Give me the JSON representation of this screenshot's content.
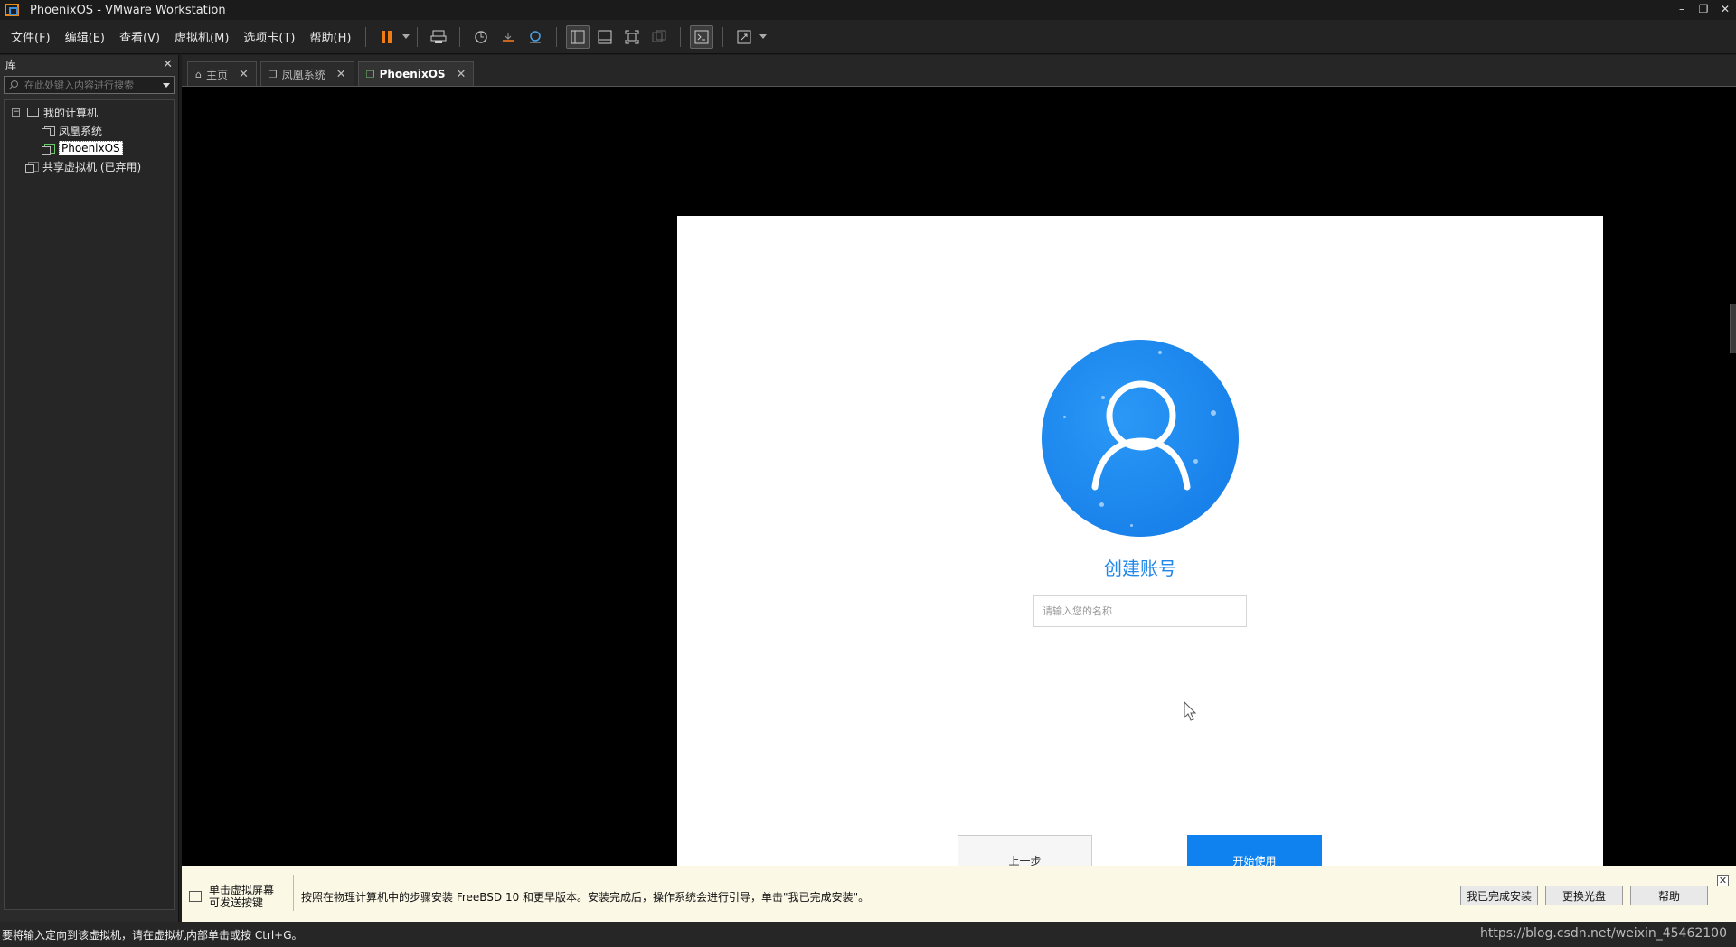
{
  "window": {
    "title": "PhoenixOS - VMware Workstation",
    "minimize": "–",
    "restore": "❐",
    "close": "✕"
  },
  "menu": [
    {
      "label": "文件(F)"
    },
    {
      "label": "编辑(E)"
    },
    {
      "label": "查看(V)"
    },
    {
      "label": "虚拟机(M)"
    },
    {
      "label": "选项卡(T)"
    },
    {
      "label": "帮助(H)"
    }
  ],
  "library": {
    "title": "库",
    "search_placeholder": "在此处键入内容进行搜索",
    "tree": {
      "my_computer": "我的计算机",
      "vm1": "凤凰系统",
      "vm2": "PhoenixOS",
      "shared": "共享虚拟机 (已弃用)"
    }
  },
  "tabs": [
    {
      "label": "主页"
    },
    {
      "label": "凤凰系统"
    },
    {
      "label": "PhoenixOS"
    }
  ],
  "guest": {
    "title": "创建账号",
    "name_placeholder": "请输入您的名称",
    "prev_label": "上一步",
    "start_label": "开始使用",
    "accent": "#1f86ea"
  },
  "hint": {
    "click_line1": "单击虚拟屏幕",
    "click_line2": "可发送按键",
    "message": "按照在物理计算机中的步骤安装 FreeBSD 10 和更早版本。安装完成后，操作系统会进行引导，单击\"我已完成安装\"。",
    "btn_done": "我已完成安装",
    "btn_change_disc": "更换光盘",
    "btn_help": "帮助"
  },
  "status": {
    "text": "要将输入定向到该虚拟机，请在虚拟机内部单击或按 Ctrl+G。",
    "watermark": "https://blog.csdn.net/weixin_45462100"
  }
}
